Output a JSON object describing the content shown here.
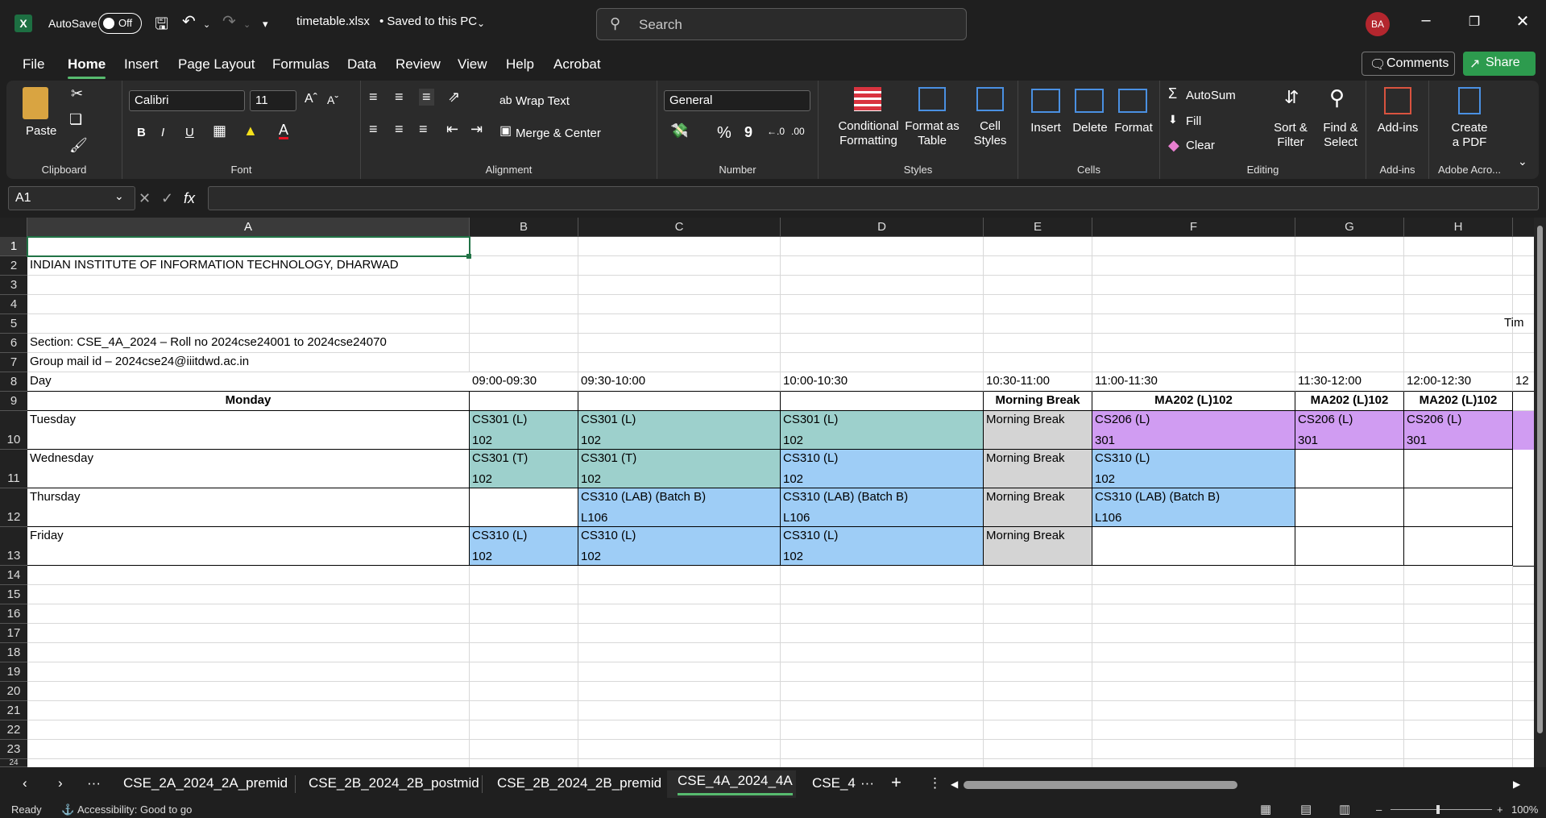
{
  "titlebar": {
    "autosave_label": "AutoSave",
    "autosave_state": "Off",
    "filename": "timetable.xlsx",
    "save_status": "• Saved to this PC",
    "search_placeholder": "Search",
    "avatar_initials": "BA"
  },
  "menu": {
    "items": [
      "File",
      "Home",
      "Insert",
      "Page Layout",
      "Formulas",
      "Data",
      "Review",
      "View",
      "Help",
      "Acrobat"
    ],
    "active": "Home",
    "comments": "Comments",
    "share": "Share"
  },
  "ribbon": {
    "clipboard": {
      "paste": "Paste",
      "label": "Clipboard"
    },
    "font": {
      "name": "Calibri",
      "size": "11",
      "bold": "B",
      "italic": "I",
      "underline": "U",
      "label": "Font"
    },
    "alignment": {
      "wrap": "Wrap Text",
      "merge": "Merge & Center",
      "label": "Alignment"
    },
    "number": {
      "format": "General",
      "percent": "%",
      "comma": "9",
      "label": "Number"
    },
    "styles": {
      "conditional": "Conditional",
      "conditional2": "Formatting",
      "format_table": "Format as",
      "format_table2": "Table",
      "cell_styles": "Cell",
      "cell_styles2": "Styles",
      "label": "Styles"
    },
    "cells": {
      "insert": "Insert",
      "delete": "Delete",
      "format": "Format",
      "label": "Cells"
    },
    "editing": {
      "autosum": "AutoSum",
      "fill": "Fill",
      "clear": "Clear",
      "sort": "Sort &",
      "sort2": "Filter",
      "find": "Find &",
      "find2": "Select",
      "label": "Editing"
    },
    "addins": {
      "addins": "Add-ins",
      "label": "Add-ins"
    },
    "acrobat": {
      "create": "Create",
      "create2": "a PDF",
      "label": "Adobe Acro..."
    }
  },
  "formula_bar": {
    "name_box": "A1",
    "formula": ""
  },
  "columns": [
    "A",
    "B",
    "C",
    "D",
    "E",
    "F",
    "G",
    "H"
  ],
  "rows": [
    "1",
    "2",
    "3",
    "4",
    "5",
    "6",
    "7",
    "8",
    "9",
    "10",
    "11",
    "12",
    "13",
    "14",
    "15",
    "16",
    "17",
    "18",
    "19",
    "20",
    "21",
    "22",
    "23",
    "24"
  ],
  "sheet": {
    "r2": "INDIAN INSTITUTE OF INFORMATION TECHNOLOGY, DHARWAD",
    "r5_h": "Tim",
    "r6": "Section: CSE_4A_2024 – Roll no 2024cse24001 to 2024cse24070",
    "r7": "Group mail id – 2024cse24@iiitdwd.ac.in",
    "r8": {
      "A": "Day",
      "B": "09:00-09:30",
      "C": "09:30-10:00",
      "D": "10:00-10:30",
      "E": "10:30-11:00",
      "F": "11:00-11:30",
      "G": "11:30-12:00",
      "H": "12:00-12:30",
      "I": "12"
    },
    "r9": {
      "A": "Monday",
      "E": "Morning Break",
      "F": "MA202 (L)102",
      "G": "MA202 (L)102",
      "H": "MA202 (L)102"
    },
    "r10": {
      "A": "Tuesday",
      "B1": "CS301 (L)",
      "B2": "102",
      "C1": "CS301 (L)",
      "C2": "102",
      "D1": "CS301 (L)",
      "D2": "102",
      "E1": "Morning Break",
      "F1": "CS206 (L)",
      "F2": "301",
      "G1": "CS206 (L)",
      "G2": "301",
      "H1": "CS206 (L)",
      "H2": "301"
    },
    "r11": {
      "A": "Wednesday",
      "B1": "CS301 (T)",
      "B2": "102",
      "C1": "CS301 (T)",
      "C2": "102",
      "D1": "CS310 (L)",
      "D2": "102",
      "E1": "Morning Break",
      "F1": "CS310 (L)",
      "F2": "102"
    },
    "r12": {
      "A": "Thursday",
      "C1": "CS310 (LAB) (Batch B)",
      "C2": "L106",
      "D1": "CS310 (LAB) (Batch B)",
      "D2": "L106",
      "E1": "Morning Break",
      "F1": "CS310 (LAB) (Batch B)",
      "F2": "L106"
    },
    "r13": {
      "A": "Friday",
      "B1": "CS310 (L)",
      "B2": "102",
      "C1": "CS310 (L)",
      "C2": "102",
      "D1": "CS310 (L)",
      "D2": "102",
      "E1": "Morning Break"
    }
  },
  "tabs": {
    "items": [
      "CSE_2A_2024_2A_premid",
      "CSE_2B_2024_2B_postmid",
      "CSE_2B_2024_2B_premid",
      "CSE_4A_2024_4A",
      "CSE_4"
    ],
    "active_index": 3
  },
  "status": {
    "ready": "Ready",
    "accessibility": "Accessibility: Good to go",
    "zoom": "100%"
  },
  "colors": {
    "teal": "#9dd0cc",
    "blue": "#9ecdf6",
    "grey": "#d4d4d4",
    "purple": "#d09cf2",
    "accent": "#57bb6f"
  }
}
